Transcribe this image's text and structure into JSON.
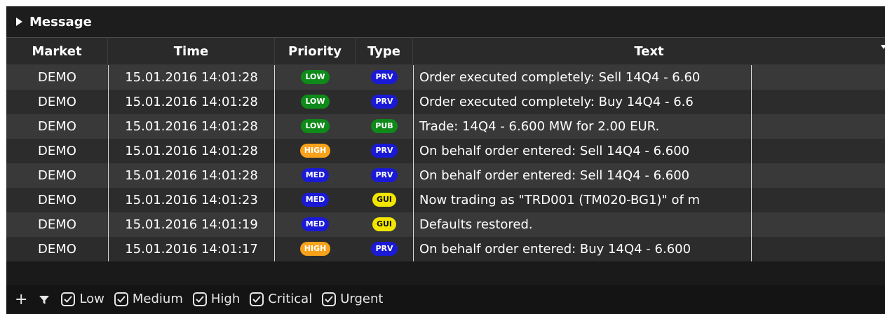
{
  "panel": {
    "title": "Message"
  },
  "columns": {
    "market": "Market",
    "time": "Time",
    "priority": "Priority",
    "type": "Type",
    "text": "Text"
  },
  "rows": [
    {
      "market": "DEMO",
      "time": "15.01.2016 14:01:28",
      "priority": "LOW",
      "type": "PRV",
      "text": "Order executed completely: Sell 14Q4 - 6.60"
    },
    {
      "market": "DEMO",
      "time": "15.01.2016 14:01:28",
      "priority": "LOW",
      "type": "PRV",
      "text": "Order executed completely: Buy 14Q4 - 6.6"
    },
    {
      "market": "DEMO",
      "time": "15.01.2016 14:01:28",
      "priority": "LOW",
      "type": "PUB",
      "text": "Trade: 14Q4 - 6.600 MW for 2.00 EUR."
    },
    {
      "market": "DEMO",
      "time": "15.01.2016 14:01:28",
      "priority": "HIGH",
      "type": "PRV",
      "text": "On behalf order entered: Sell 14Q4 - 6.600"
    },
    {
      "market": "DEMO",
      "time": "15.01.2016 14:01:28",
      "priority": "MED",
      "type": "PRV",
      "text": "On behalf order entered: Sell 14Q4 - 6.600"
    },
    {
      "market": "DEMO",
      "time": "15.01.2016 14:01:23",
      "priority": "MED",
      "type": "GUI",
      "text": "Now trading as \"TRD001 (TM020-BG1)\" of m"
    },
    {
      "market": "DEMO",
      "time": "15.01.2016 14:01:19",
      "priority": "MED",
      "type": "GUI",
      "text": "Defaults restored."
    },
    {
      "market": "DEMO",
      "time": "15.01.2016 14:01:17",
      "priority": "HIGH",
      "type": "PRV",
      "text": "On behalf order entered: Buy 14Q4 - 6.600"
    }
  ],
  "badge_colors": {
    "LOW": {
      "bg": "#0f8a1a",
      "fg": "#ffffff"
    },
    "MED": {
      "bg": "#1a1ad6",
      "fg": "#ffffff"
    },
    "HIGH": {
      "bg": "#f7a21a",
      "fg": "#ffffff"
    },
    "PRV": {
      "bg": "#1a1ad6",
      "fg": "#ffffff"
    },
    "PUB": {
      "bg": "#0f8a1a",
      "fg": "#ffffff"
    },
    "GUI": {
      "bg": "#f2e600",
      "fg": "#111111"
    }
  },
  "footer": {
    "add_icon": "plus-icon",
    "filter_icon": "filter-icon",
    "filters": [
      {
        "label": "Low",
        "checked": true
      },
      {
        "label": "Medium",
        "checked": true
      },
      {
        "label": "High",
        "checked": true
      },
      {
        "label": "Critical",
        "checked": true
      },
      {
        "label": "Urgent",
        "checked": true
      }
    ]
  }
}
